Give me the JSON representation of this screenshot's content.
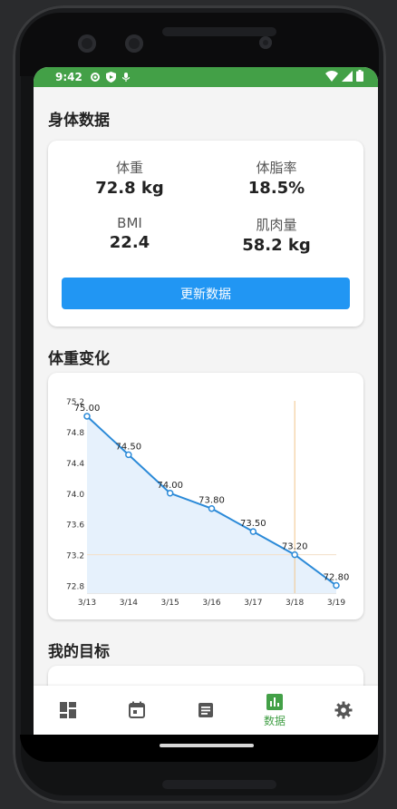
{
  "status_bar": {
    "time": "9:42"
  },
  "page_title": "身体数据",
  "stats": [
    {
      "label": "体重",
      "value": "72.8 kg"
    },
    {
      "label": "体脂率",
      "value": "18.5%"
    },
    {
      "label": "BMI",
      "value": "22.4"
    },
    {
      "label": "肌肉量",
      "value": "58.2 kg"
    }
  ],
  "update_button": "更新数据",
  "weight_section_title": "体重变化",
  "goals_section_title": "我的目标",
  "nav": {
    "active_label": "数据"
  },
  "colors": {
    "accent": "#2196f3",
    "status_bar": "#43a047",
    "chart_line": "#2b8ad8"
  },
  "chart_data": {
    "type": "line",
    "x": [
      "3/13",
      "3/14",
      "3/15",
      "3/16",
      "3/17",
      "3/18",
      "3/19"
    ],
    "series": [
      {
        "values": [
          75.0,
          74.5,
          74.0,
          73.8,
          73.5,
          73.2,
          72.8
        ],
        "labels": [
          "75.00",
          "74.50",
          "74.00",
          "73.80",
          "73.50",
          "73.20",
          "72.80"
        ]
      }
    ],
    "y_ticks": [
      "75.2",
      "74.8",
      "74.4",
      "74.0",
      "73.6",
      "73.2",
      "72.8"
    ],
    "ylim": [
      72.7,
      75.2
    ],
    "highlight": {
      "x": "3/18",
      "y": 73.2
    },
    "area_fill": true,
    "grid": false
  }
}
